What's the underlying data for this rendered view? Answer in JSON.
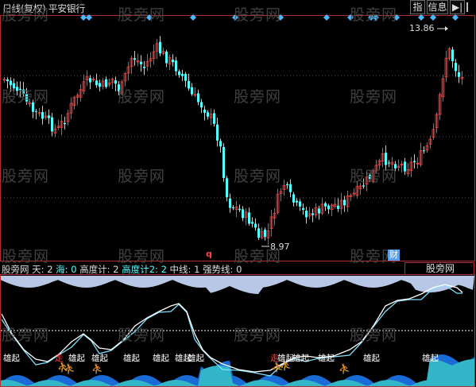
{
  "header": {
    "title": "日线(复权)",
    "stock": "平安银行",
    "btn_index": "指",
    "btn_info": "信息",
    "btn_menu": "▶|"
  },
  "watermark": "股旁网",
  "price": {
    "high_label": "13.86",
    "low_label": "8.97",
    "q_mark": "q",
    "cai_badge": "财"
  },
  "indicator": {
    "name": "股旁网",
    "tian_label": "天:",
    "tian_value": "2",
    "hai_label": "海:",
    "hai_value": "0",
    "gaodu_label": "高度计:",
    "gaodu_value": "2",
    "gaodu2_label": "高度计2:",
    "gaodu2_value": "2",
    "zhong_label": "中线:",
    "zhong_value": "1",
    "qiang_label": "强势线:",
    "qiang_value": "0",
    "right_box_label": "股旁网",
    "xiongqi": "雄起",
    "zou": "走"
  },
  "colors": {
    "up": "#ff3c3c",
    "down": "#54ffff",
    "grid_red": "#b03030",
    "diamond": "#4ab8ff",
    "area_cyan": "#33b5c8",
    "area_blue": "#1a6bd6",
    "line_white": "#ffffff",
    "line_cyan": "#7fe0ff",
    "sky": "#b7c8e6"
  }
}
